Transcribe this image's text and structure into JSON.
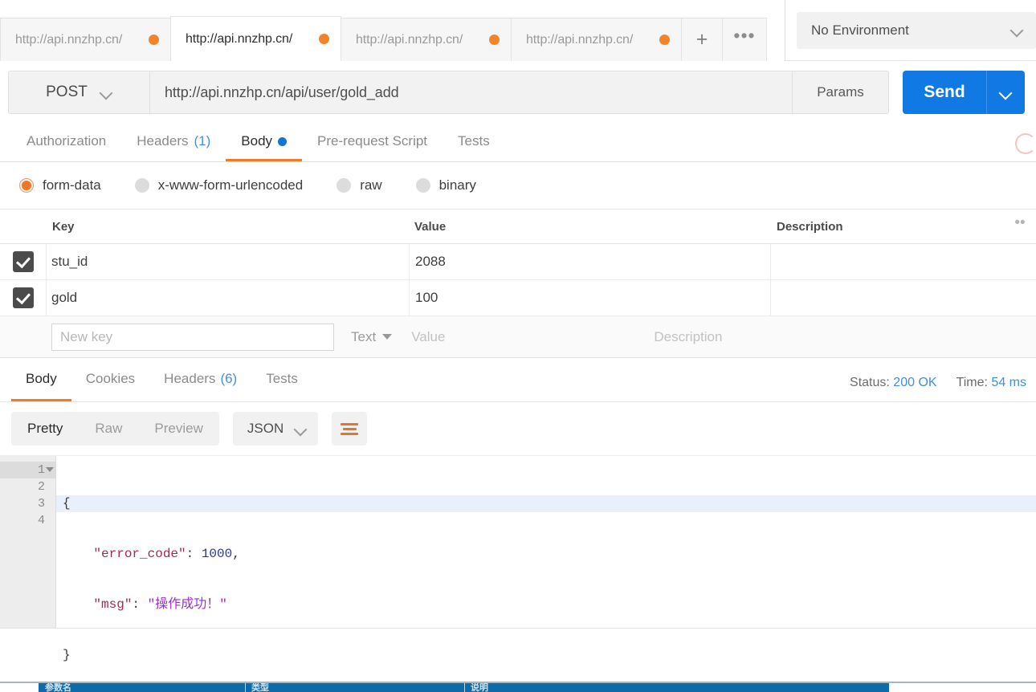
{
  "tabbar": {
    "tabs": [
      {
        "label": "http://api.nnzhp.cn/",
        "active": false
      },
      {
        "label": "http://api.nnzhp.cn/",
        "active": true
      },
      {
        "label": "http://api.nnzhp.cn/",
        "active": false
      },
      {
        "label": "http://api.nnzhp.cn/",
        "active": false
      }
    ],
    "new_tab_icon": "plus-icon",
    "more_icon": "ellipsis-icon"
  },
  "environment": {
    "selected": "No Environment",
    "chevron_icon": "chevron-down-icon"
  },
  "request": {
    "method": "POST",
    "method_chevron_icon": "chevron-down-icon",
    "url": "http://api.nnzhp.cn/api/user/gold_add",
    "params_label": "Params",
    "send_label": "Send",
    "send_caret_icon": "chevron-down-icon",
    "tabs": [
      {
        "label": "Authorization",
        "count": "",
        "active": false,
        "dot": false
      },
      {
        "label": "Headers",
        "count": "(1)",
        "active": false,
        "dot": false
      },
      {
        "label": "Body",
        "count": "",
        "active": true,
        "dot": true
      },
      {
        "label": "Pre-request Script",
        "count": "",
        "active": false,
        "dot": false
      },
      {
        "label": "Tests",
        "count": "",
        "active": false,
        "dot": false
      }
    ],
    "body_types": [
      {
        "label": "form-data",
        "selected": true
      },
      {
        "label": "x-www-form-urlencoded",
        "selected": false
      },
      {
        "label": "raw",
        "selected": false
      },
      {
        "label": "binary",
        "selected": false
      }
    ],
    "table": {
      "headers": {
        "key": "Key",
        "value": "Value",
        "description": "Description"
      },
      "bulk_edit_icon": "ellipsis-icon",
      "rows": [
        {
          "checked": true,
          "key": "stu_id",
          "value": "2088",
          "description": ""
        },
        {
          "checked": true,
          "key": "gold",
          "value": "100",
          "description": ""
        }
      ],
      "new_row": {
        "key_placeholder": "New key",
        "key_value": "",
        "type_label": "Text",
        "type_caret_icon": "caret-down-icon",
        "value_placeholder": "Value",
        "description_placeholder": "Description"
      }
    }
  },
  "response": {
    "tabs": [
      {
        "label": "Body",
        "count": "",
        "active": true
      },
      {
        "label": "Cookies",
        "count": "",
        "active": false
      },
      {
        "label": "Headers",
        "count": "(6)",
        "active": false
      },
      {
        "label": "Tests",
        "count": "",
        "active": false
      }
    ],
    "status_label": "Status:",
    "status_value": "200 OK",
    "time_label": "Time:",
    "time_value": "54 ms",
    "view_modes": [
      {
        "label": "Pretty",
        "active": true
      },
      {
        "label": "Raw",
        "active": false
      },
      {
        "label": "Preview",
        "active": false
      }
    ],
    "format": "JSON",
    "format_chevron_icon": "chevron-down-icon",
    "wrap_icon": "word-wrap-icon",
    "lines": [
      "1",
      "2",
      "3",
      "4"
    ],
    "body": {
      "line1": "{",
      "line2_key": "\"error_code\"",
      "line2_colon": ": ",
      "line2_num": "1000",
      "line2_comma": ",",
      "line3_key": "\"msg\"",
      "line3_colon": ": ",
      "line3_str": "\"操作成功！\"",
      "line4": "}"
    }
  },
  "background_window": {
    "columns": [
      "参数名",
      "类型",
      "说明"
    ]
  },
  "colors": {
    "accent_orange": "#ef7b24",
    "send_blue": "#1179e3",
    "link_blue": "#3e8fdd",
    "tab_dot": "#f3842a"
  }
}
